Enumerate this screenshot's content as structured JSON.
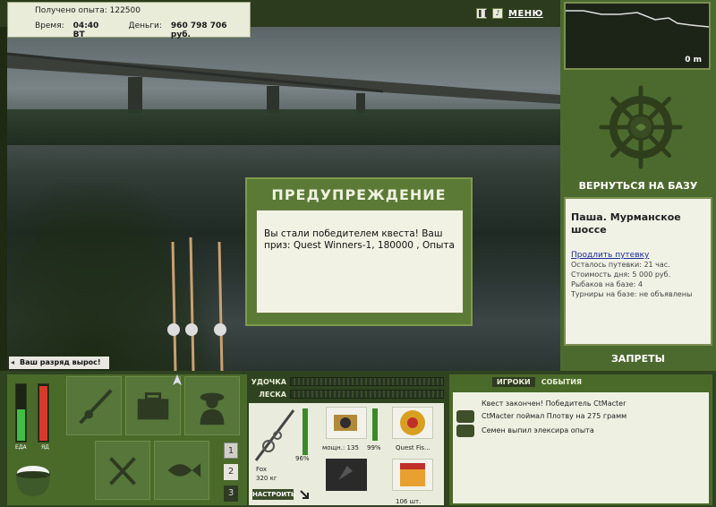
{
  "header": {
    "xp_label": "Получено опыта:",
    "xp_value": "122500",
    "time_label": "Время:",
    "time_value": "04:40 ВТ",
    "money_label": "Деньги:",
    "money_value": "960 798 706 руб.",
    "pause_icon": "pause-icon",
    "sound_icon": "sound-icon",
    "menu_label": "МЕНЮ"
  },
  "depth": {
    "value_label": "0 m"
  },
  "base": {
    "return_label": "ВЕРНУТЬСЯ НА БАЗУ",
    "title": "Паша. Мурманское шоссе",
    "extend_link": "Продлить путевку",
    "left_time": "Осталось путевки: 21 час.",
    "day_cost": "Стоимость дня: 5 000 руб.",
    "anglers": "Рыбаков на базе: 4",
    "tournaments": "Турниры на базе: не объявлены",
    "bans_label": "ЗАПРЕТЫ"
  },
  "dialog": {
    "title": "ПРЕДУПРЕЖДЕНИЕ",
    "message": "Вы стали победителем квеста! Ваш приз: Quest Winners-1, 180000 , Опыта"
  },
  "notice": {
    "rank_text": "Ваш разряд вырос!"
  },
  "gauges": {
    "food_label": "ЕДА",
    "food_level": 0.55,
    "poison_label": "ЯД",
    "poison_level": 0.95,
    "food_color": "#3fbf3f",
    "poison_color": "#d83a2a"
  },
  "pages": [
    "1",
    "2",
    "3"
  ],
  "bars": {
    "rod_label": "УДОЧКА",
    "line_label": "ЛЕСКА"
  },
  "tackle": {
    "rod_percent": "96%",
    "rod_name": "Fox",
    "rod_weight": "320 кг",
    "reel_power": "мощн.: 135",
    "reel_percent": "99%",
    "line_name": "Quest Fis...",
    "bait_count": "106 шт.",
    "set_label": "НАСТРОИТЬ"
  },
  "events": {
    "tabs": [
      "ИГРОКИ",
      "СОБЫТИЯ"
    ],
    "items": [
      "Квест закончен! Победитель CtMacter",
      "CtMacter поймал Плотву на 275 грамм",
      "Семен выпил элексира опыта"
    ]
  }
}
